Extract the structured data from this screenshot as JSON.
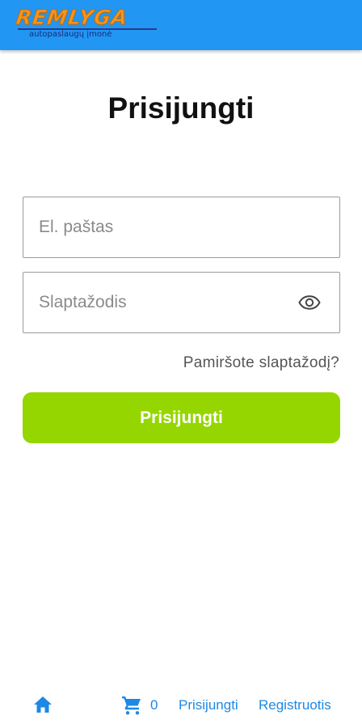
{
  "header": {
    "brand": "REMLYGA",
    "tagline": "autopaslaugų įmonė",
    "background_color": "#2196f3",
    "logo_color": "#f7941d"
  },
  "page": {
    "title": "Prisijungti"
  },
  "form": {
    "email_placeholder": "El. paštas",
    "email_value": "",
    "password_placeholder": "Slaptažodis",
    "password_value": "",
    "password_toggle_icon": "eye-icon",
    "forgot_label": "Pamiršote slaptažodį?",
    "submit_label": "Prisijungti",
    "submit_color": "#95d600"
  },
  "bottom_nav": {
    "home_icon": "home-icon",
    "cart_icon": "cart-icon",
    "cart_count": "0",
    "login_label": "Prisijungti",
    "register_label": "Registruotis",
    "link_color": "#1e88e5"
  }
}
